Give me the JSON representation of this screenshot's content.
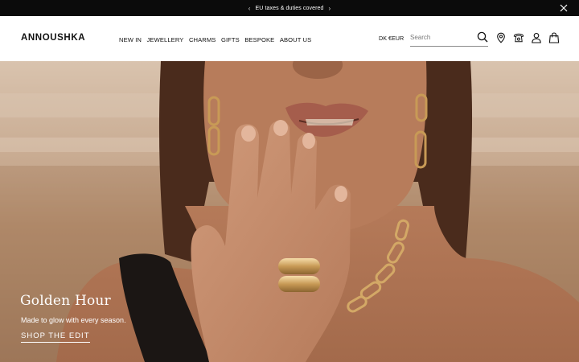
{
  "announcement": {
    "text": "EU taxes & duties covered",
    "prev_arrow": "‹",
    "next_arrow": "›"
  },
  "header": {
    "logo": "ANNOUSHKA",
    "nav": [
      "NEW IN",
      "JEWELLERY",
      "CHARMS",
      "GIFTS",
      "BESPOKE",
      "ABOUT US"
    ],
    "currency": "DK €EUR",
    "search": {
      "placeholder": "Search",
      "value": ""
    }
  },
  "hero": {
    "title": "Golden Hour",
    "subtitle": "Made to glow with every season.",
    "cta": "SHOP THE EDIT"
  },
  "icons": {
    "close": "close-icon",
    "search": "search-icon",
    "store": "location-pin-icon",
    "contact": "telephone-icon",
    "account": "user-icon",
    "bag": "shopping-bag-icon"
  },
  "colors": {
    "announcement_bg": "#0b0b0b",
    "text": "#111111",
    "hero_text": "#ffffff"
  }
}
